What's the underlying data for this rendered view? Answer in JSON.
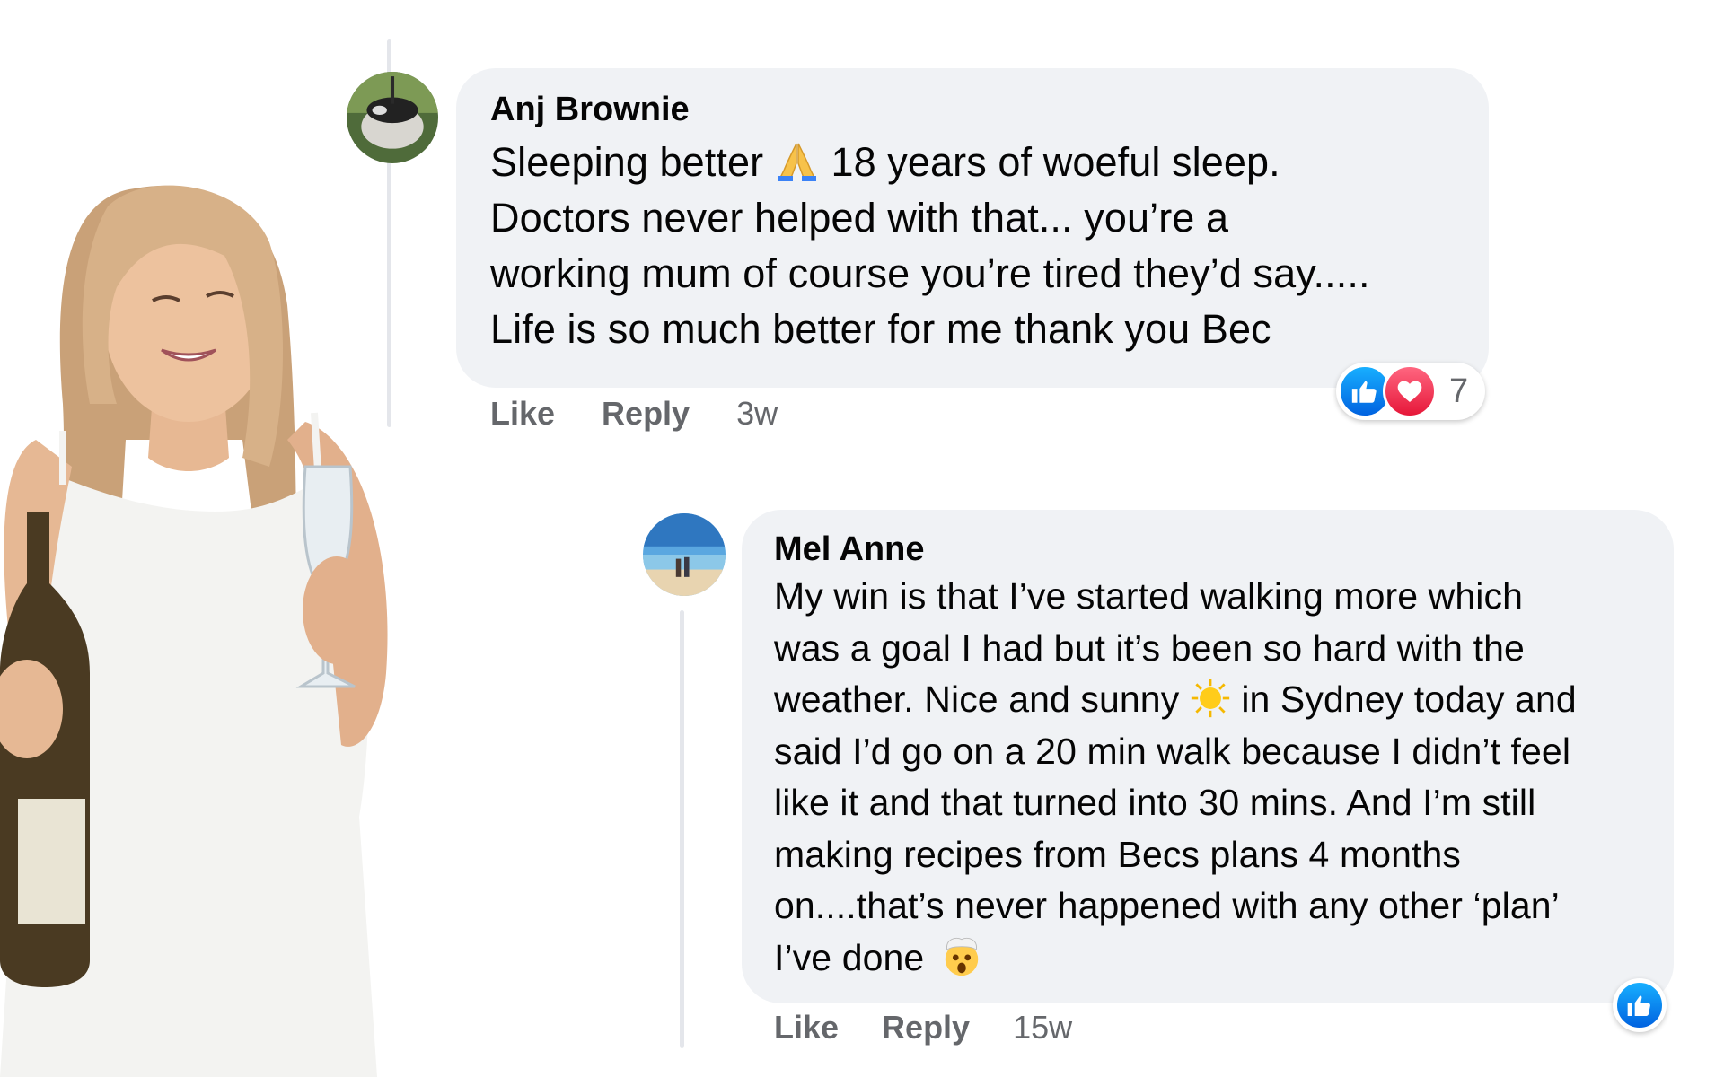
{
  "comments": [
    {
      "author": "Anj Brownie",
      "text_lines": [
        "Sleeping better",
        "18 years of woeful sleep.",
        "Doctors never helped with that... you’re a",
        "working mum of course you’re tired they’d say.....",
        "Life is so much better for me thank you Bec"
      ],
      "emoji": "folded-hands",
      "actions": {
        "like": "Like",
        "reply": "Reply",
        "time": "3w"
      },
      "reactions": {
        "types": [
          "like",
          "love"
        ],
        "count": "7"
      }
    },
    {
      "author": "Mel Anne",
      "text_lines": [
        "My win is that I’ve started walking more which",
        "was a goal I had but it’s been so hard with the",
        "weather. Nice and sunny",
        "in Sydney today and",
        "said I’d go on a 20 min walk because I didn’t feel",
        "like it and that turned into 30 mins. And I’m still",
        "making recipes from Becs plans 4 months",
        "on....that’s never happened with any other ‘plan’",
        "I’ve done"
      ],
      "emojis": [
        "sun",
        "exploding-head"
      ],
      "actions": {
        "like": "Like",
        "reply": "Reply",
        "time": "15w"
      },
      "reactions": {
        "types": [
          "like"
        ]
      }
    }
  ],
  "colors": {
    "bubble": "#f0f2f5",
    "action_text": "#65676b",
    "like_blue": "#1877f2",
    "love_red": "#f33e58",
    "thread_line": "#e4e6eb"
  }
}
